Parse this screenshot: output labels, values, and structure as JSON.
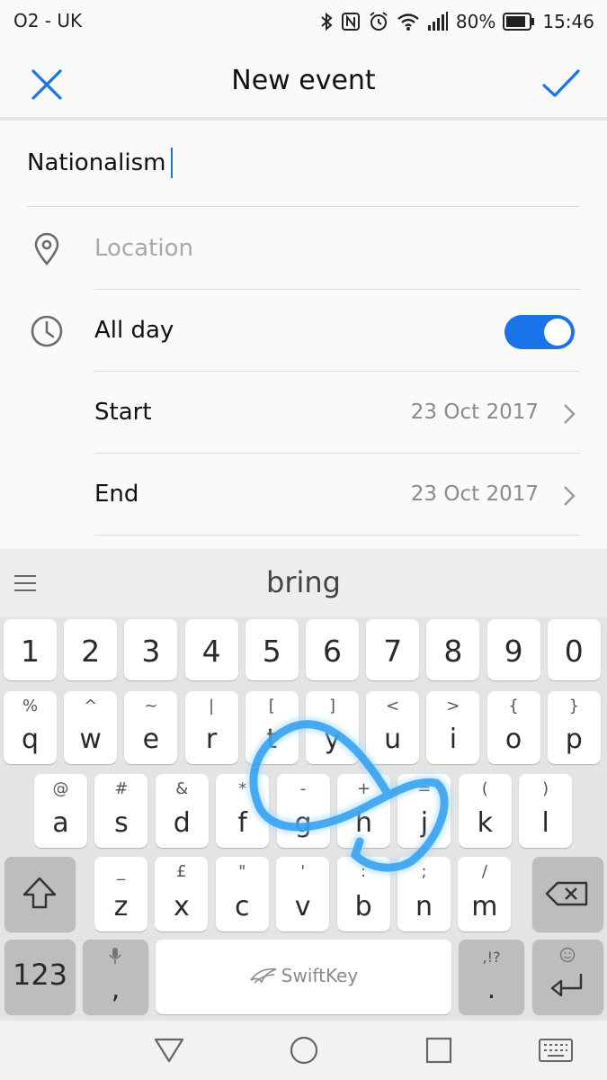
{
  "status_bar": {
    "carrier": "O2 - UK",
    "battery": "80%",
    "time": "15:46",
    "icons": [
      "bluetooth-icon",
      "nfc-icon",
      "alarm-icon",
      "wifi-icon",
      "signal-icon",
      "battery-icon"
    ]
  },
  "header": {
    "title": "New event",
    "close_icon": "close-icon",
    "confirm_icon": "check-icon",
    "accent_color": "#1a73e8"
  },
  "form": {
    "title_value": "Nationalism",
    "location": {
      "placeholder": "Location",
      "icon": "location-pin-icon"
    },
    "all_day": {
      "label": "All day",
      "icon": "clock-icon",
      "enabled": true
    },
    "start": {
      "label": "Start",
      "value": "23 Oct 2017"
    },
    "end": {
      "label": "End",
      "value": "23 Oct 2017"
    }
  },
  "keyboard": {
    "suggestion": "bring",
    "number_row": [
      "1",
      "2",
      "3",
      "4",
      "5",
      "6",
      "7",
      "8",
      "9",
      "0"
    ],
    "row1": [
      {
        "main": "q",
        "sub": "%"
      },
      {
        "main": "w",
        "sub": "^"
      },
      {
        "main": "e",
        "sub": "~"
      },
      {
        "main": "r",
        "sub": "|"
      },
      {
        "main": "t",
        "sub": "["
      },
      {
        "main": "y",
        "sub": "]"
      },
      {
        "main": "u",
        "sub": "<"
      },
      {
        "main": "i",
        "sub": ">"
      },
      {
        "main": "o",
        "sub": "{"
      },
      {
        "main": "p",
        "sub": "}"
      }
    ],
    "row2": [
      {
        "main": "a",
        "sub": "@"
      },
      {
        "main": "s",
        "sub": "#"
      },
      {
        "main": "d",
        "sub": "&"
      },
      {
        "main": "f",
        "sub": "*"
      },
      {
        "main": "g",
        "sub": "-"
      },
      {
        "main": "h",
        "sub": "+"
      },
      {
        "main": "j",
        "sub": "="
      },
      {
        "main": "k",
        "sub": "("
      },
      {
        "main": "l",
        "sub": ")"
      }
    ],
    "row3": [
      {
        "main": "z",
        "sub": "_"
      },
      {
        "main": "x",
        "sub": "£"
      },
      {
        "main": "c",
        "sub": "\""
      },
      {
        "main": "v",
        "sub": "'"
      },
      {
        "main": "b",
        "sub": ":"
      },
      {
        "main": "n",
        "sub": ";"
      },
      {
        "main": "m",
        "sub": "/"
      }
    ],
    "numbers_key": "123",
    "comma_key": ",",
    "period_key": ".",
    "period_sub": ",!?",
    "space_brand": "SwiftKey",
    "swipe_color": "#2f9ff0"
  },
  "nav_bar": {
    "icons": [
      "back-icon",
      "home-icon",
      "recents-icon",
      "keyboard-switch-icon"
    ]
  }
}
